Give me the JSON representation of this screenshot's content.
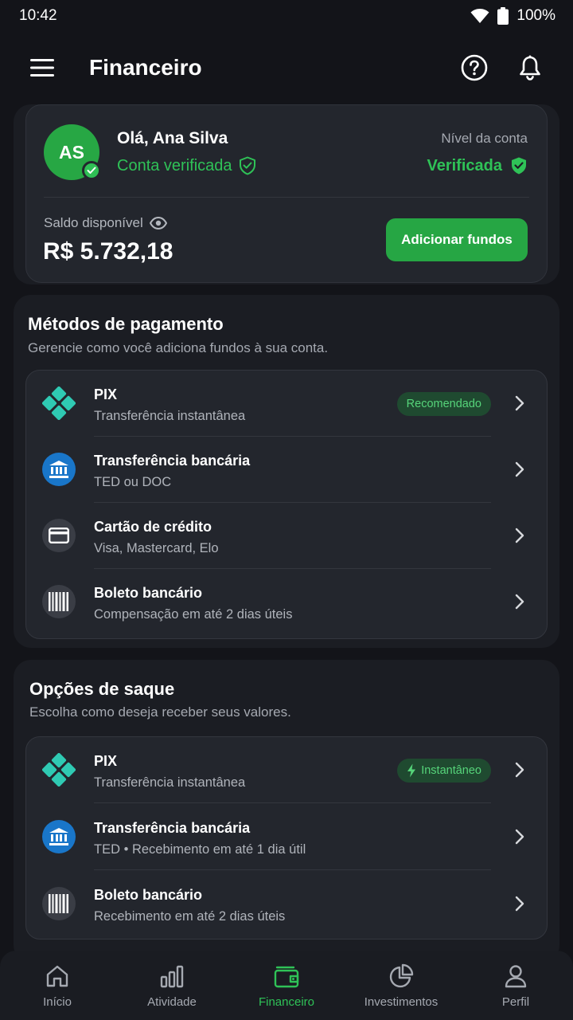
{
  "status_bar": {
    "time": "10:42",
    "battery": "100%"
  },
  "app_bar": {
    "title": "Financeiro"
  },
  "account": {
    "initials": "AS",
    "greeting": "Olá, Ana Silva",
    "verified_text": "Conta verificada",
    "level_label": "Nível da conta",
    "level_value": "Verificada",
    "balance_label": "Saldo disponível",
    "balance_value": "R$ 5.732,18",
    "add_funds_label": "Adicionar fundos"
  },
  "payment_methods": {
    "title": "Métodos de pagamento",
    "subtitle": "Gerencie como você adiciona fundos à sua conta.",
    "items": [
      {
        "title": "PIX",
        "subtitle": "Transferência instantânea",
        "badge": "Recomendado",
        "icon": "pix-icon"
      },
      {
        "title": "Transferência bancária",
        "subtitle": "TED ou DOC",
        "icon": "bank-icon"
      },
      {
        "title": "Cartão de crédito",
        "subtitle": "Visa, Mastercard, Elo",
        "icon": "credit-card-icon"
      },
      {
        "title": "Boleto bancário",
        "subtitle": "Compensação em até 2 dias úteis",
        "icon": "barcode-icon"
      }
    ]
  },
  "withdraw_options": {
    "title": "Opções de saque",
    "subtitle": "Escolha como deseja receber seus valores.",
    "items": [
      {
        "title": "PIX",
        "subtitle": "Transferência instantânea",
        "badge": "Instantâneo",
        "icon": "pix-icon"
      },
      {
        "title": "Transferência bancária",
        "subtitle": "TED • Recebimento em até 1 dia útil",
        "icon": "bank-icon"
      },
      {
        "title": "Boleto bancário",
        "subtitle": "Recebimento em até 2 dias úteis",
        "icon": "barcode-icon"
      }
    ]
  },
  "bottom_nav": {
    "items": [
      {
        "label": "Início",
        "icon": "home-icon"
      },
      {
        "label": "Atividade",
        "icon": "bar-chart-icon"
      },
      {
        "label": "Financeiro",
        "icon": "wallet-icon",
        "active": true
      },
      {
        "label": "Investimentos",
        "icon": "pie-chart-icon"
      },
      {
        "label": "Perfil",
        "icon": "person-icon"
      }
    ]
  },
  "colors": {
    "accent": "#2fc257",
    "button": "#26a644",
    "background": "#131419",
    "card": "#23262d",
    "bank_blue": "#1976c9"
  }
}
